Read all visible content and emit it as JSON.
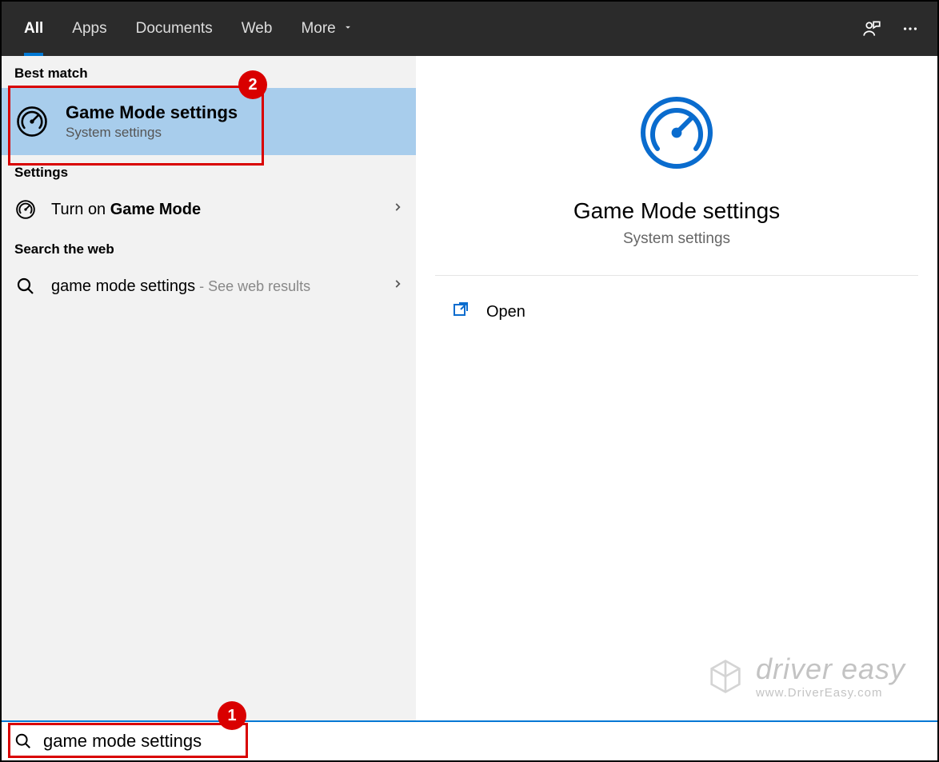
{
  "tabs": {
    "all": "All",
    "apps": "Apps",
    "documents": "Documents",
    "web": "Web",
    "more": "More"
  },
  "sections": {
    "best_match": "Best match",
    "settings": "Settings",
    "search_web": "Search the web"
  },
  "best_match": {
    "title": "Game Mode settings",
    "subtitle": "System settings"
  },
  "settings_row": {
    "prefix": "Turn on ",
    "bold": "Game Mode"
  },
  "web_row": {
    "query": "game mode settings",
    "suffix": " - See web results"
  },
  "preview": {
    "title": "Game Mode settings",
    "subtitle": "System settings",
    "open": "Open"
  },
  "search": {
    "value": "game mode settings"
  },
  "annotations": {
    "badge1": "1",
    "badge2": "2"
  },
  "watermark": {
    "line1": "driver easy",
    "line2": "www.DriverEasy.com"
  }
}
